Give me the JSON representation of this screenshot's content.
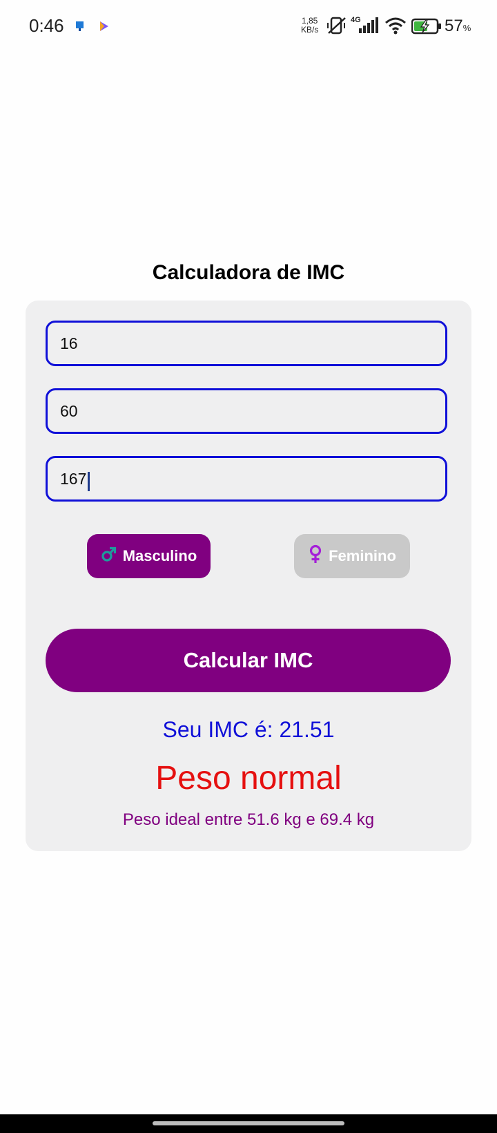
{
  "status_bar": {
    "time": "0:46",
    "net_speed_value": "1,85",
    "net_speed_unit": "KB/s",
    "network_type": "4G",
    "battery_percent": "57",
    "battery_unit": "%"
  },
  "page": {
    "title": "Calculadora de IMC"
  },
  "form": {
    "age_value": "16",
    "weight_value": "60",
    "height_value": "167",
    "gender_male_label": "Masculino",
    "gender_female_label": "Feminino",
    "selected_gender": "Masculino",
    "submit_label": "Calcular IMC"
  },
  "result": {
    "imc_text": "Seu IMC é: 21.51",
    "classification": "Peso normal",
    "ideal_weight_text": "Peso ideal entre 51.6 kg e 69.4 kg"
  },
  "colors": {
    "accent_purple": "#800080",
    "field_border_blue": "#1010d8",
    "classification_red": "#e51010",
    "male_icon_teal": "#1e9c9c",
    "female_icon_purple": "#a51fd8"
  }
}
